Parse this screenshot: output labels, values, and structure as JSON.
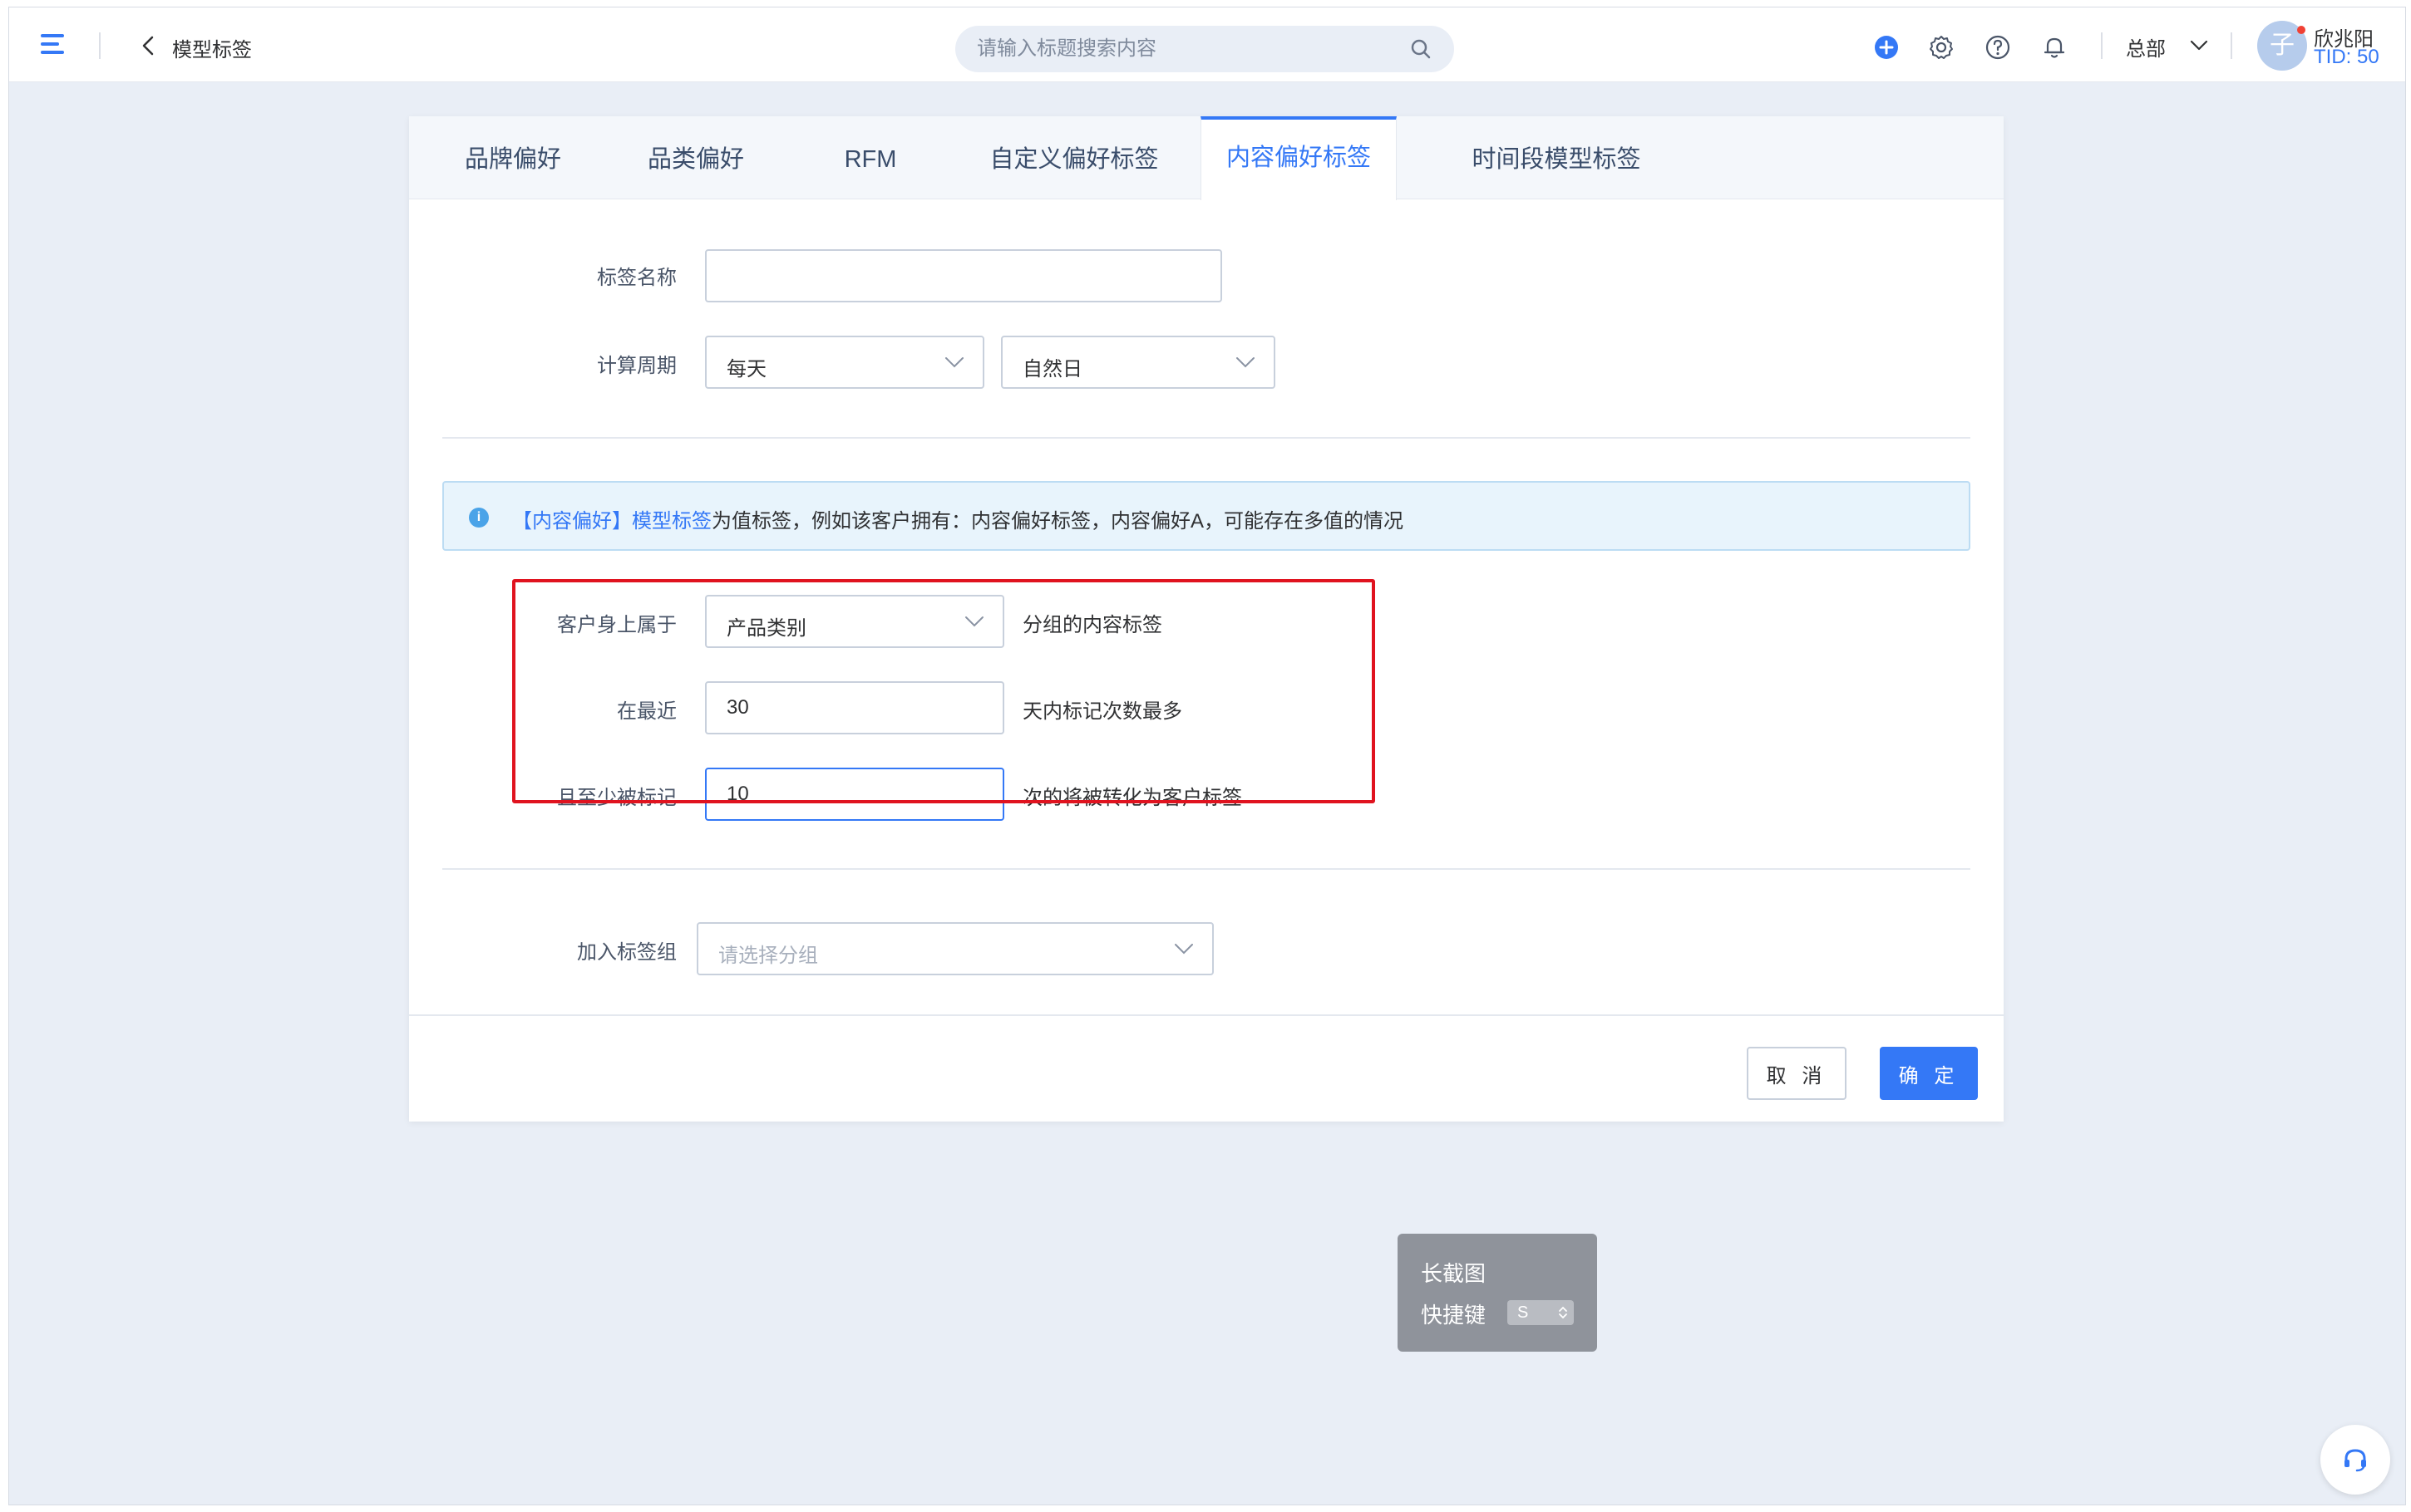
{
  "header": {
    "title": "模型标签",
    "search_placeholder": "请输入标题搜索内容",
    "department": "总部",
    "user": {
      "avatar_initial": "子",
      "name": "欣兆阳",
      "tid": "TID: 50"
    },
    "icons": [
      "menu-icon",
      "back-icon",
      "search-icon",
      "add-circle-icon",
      "gear-icon",
      "help-icon",
      "bell-icon",
      "chevron-down-icon"
    ]
  },
  "tabs": [
    {
      "label": "品牌偏好",
      "active": false
    },
    {
      "label": "品类偏好",
      "active": false
    },
    {
      "label": "RFM",
      "active": false
    },
    {
      "label": "自定义偏好标签",
      "active": false
    },
    {
      "label": "内容偏好标签",
      "active": true
    },
    {
      "label": "时间段模型标签",
      "active": false
    }
  ],
  "form": {
    "tag_name_label": "标签名称",
    "tag_name_value": "",
    "period_label": "计算周期",
    "period_value": "每天",
    "period_type_value": "自然日",
    "info_highlight": "【内容偏好】模型标签",
    "info_rest": "为值标签，例如该客户拥有：内容偏好标签，内容偏好A，可能存在多值的情况",
    "belongs_label": "客户身上属于",
    "belongs_value": "产品类别",
    "belongs_suffix": "分组的内容标签",
    "recent_label": "在最近",
    "recent_value": "30",
    "recent_suffix": "天内标记次数最多",
    "min_label": "且至少被标记",
    "min_value": "10",
    "min_suffix": "次的将被转化为客户标签",
    "group_label": "加入标签组",
    "group_placeholder": "请选择分组"
  },
  "buttons": {
    "cancel": "取 消",
    "ok": "确 定"
  },
  "screenshot_tip": {
    "title": "长截图",
    "shortcut_label": "快捷键",
    "shortcut_key": "S"
  },
  "colors": {
    "primary": "#3478f6",
    "highlight_border": "#e0131f",
    "info_bg": "#e8f4fc"
  }
}
